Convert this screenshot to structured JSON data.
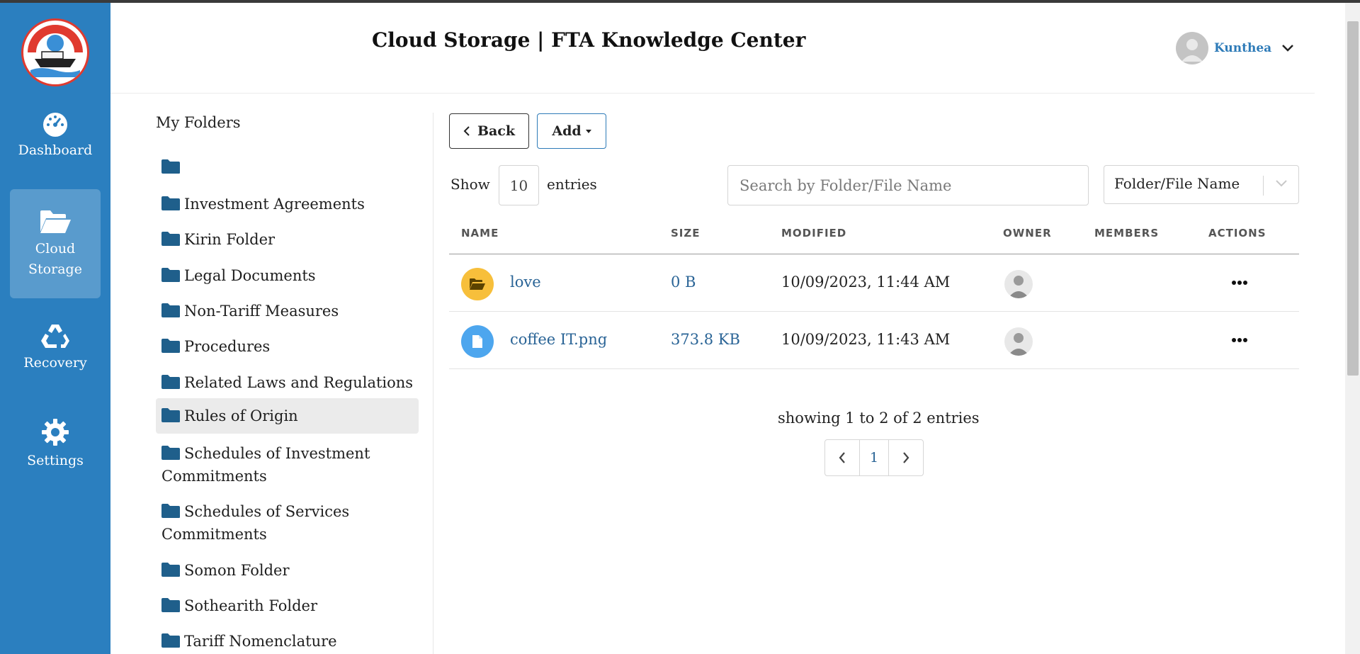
{
  "app": {
    "title": "Cloud Storage | FTA Knowledge Center",
    "user_name": "Kunthea"
  },
  "sidebar": {
    "items": [
      {
        "label": "Dashboard",
        "icon": "dashboard-gauge-icon",
        "active": false
      },
      {
        "label": "Cloud Storage",
        "icon": "folder-open-icon",
        "active": true
      },
      {
        "label": "Recovery",
        "icon": "recycle-icon",
        "active": false
      },
      {
        "label": "Settings",
        "icon": "gear-icon",
        "active": false
      }
    ]
  },
  "folders": {
    "title": "My Folders",
    "items": [
      {
        "label": ""
      },
      {
        "label": "Investment Agreements"
      },
      {
        "label": "Kirin Folder"
      },
      {
        "label": "Legal Documents"
      },
      {
        "label": "Non-Tariff Measures"
      },
      {
        "label": "Procedures"
      },
      {
        "label": "Related Laws and Regulations"
      },
      {
        "label": "Rules of Origin",
        "selected": true
      },
      {
        "label": "Schedules of Investment Commitments"
      },
      {
        "label": "Schedules of Services Commitments"
      },
      {
        "label": "Somon Folder"
      },
      {
        "label": "Sothearith Folder"
      },
      {
        "label": "Tariff Nomenclature"
      }
    ]
  },
  "toolbar": {
    "back_label": "Back",
    "add_label": "Add",
    "show_label": "Show",
    "entries_value": "10",
    "entries_label": "entries",
    "search_placeholder": "Search by Folder/File Name",
    "filter_value": "Folder/File Name"
  },
  "table": {
    "columns": [
      "NAME",
      "SIZE",
      "MODIFIED",
      "OWNER",
      "MEMBERS",
      "ACTIONS"
    ],
    "rows": [
      {
        "type": "folder",
        "name": "love",
        "size": "0 B",
        "modified": "10/09/2023, 11:44 AM",
        "members": ""
      },
      {
        "type": "file",
        "name": "coffee IT.png",
        "size": "373.8 KB",
        "modified": "10/09/2023, 11:43 AM",
        "members": ""
      }
    ]
  },
  "pagination": {
    "summary": "showing 1 to 2 of 2 entries",
    "current_page": "1"
  },
  "colors": {
    "sidebar": "#2b7fbf",
    "link": "#2a6496",
    "folder_icon": "#1f5f8b",
    "folder_badge": "#f7bf3b",
    "file_badge": "#4da6ee"
  }
}
